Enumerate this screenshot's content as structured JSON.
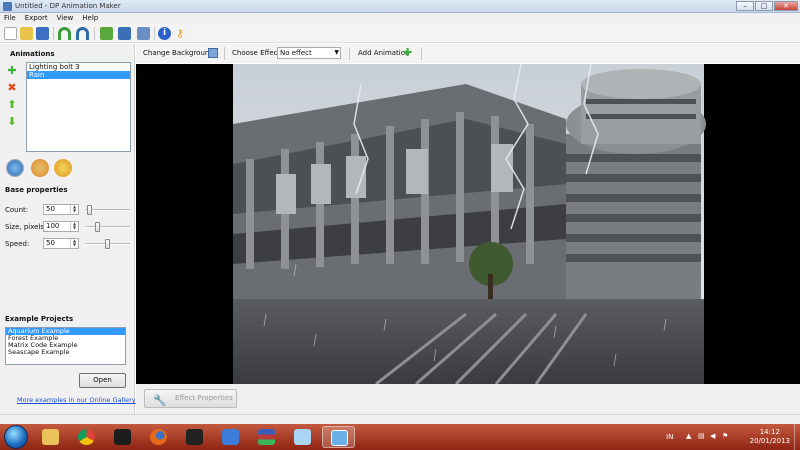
{
  "window": {
    "title": "Untitled - DP Animation Maker"
  },
  "menu": [
    "File",
    "Export",
    "View",
    "Help"
  ],
  "toolbar": {
    "icons": [
      "new-file-icon",
      "open-folder-icon",
      "save-icon",
      "undo-icon",
      "redo-icon",
      "export-image-icon",
      "export-video-icon",
      "export-screensaver-icon",
      "info-icon",
      "key-icon"
    ]
  },
  "animations": {
    "title": "Animations",
    "items": [
      {
        "label": "Lighting bolt 3",
        "selected": false
      },
      {
        "label": "Rain",
        "selected": true
      }
    ]
  },
  "base_properties": {
    "title": "Base properties",
    "rows": [
      {
        "label": "Count:",
        "value": "50",
        "slider": 0.05
      },
      {
        "label": "Size, pixels:",
        "value": "100",
        "slider": 0.25
      },
      {
        "label": "Speed:",
        "value": "50",
        "slider": 0.5
      }
    ]
  },
  "examples": {
    "title": "Example Projects",
    "items": [
      {
        "label": "Aquarium Example",
        "selected": true
      },
      {
        "label": "Forest Example",
        "selected": false
      },
      {
        "label": "Matrix Code Example",
        "selected": false
      },
      {
        "label": "Seascape Example",
        "selected": false
      }
    ],
    "open_label": "Open",
    "gallery_link": "More examples in our Online Gallery"
  },
  "effect_toolbar": {
    "change_background": "Change Background",
    "choose_effect_label": "Choose Effect:",
    "effect_value": "No effect",
    "add_animation": "Add Animation"
  },
  "bottom": {
    "effect_properties": "Effect Properties"
  },
  "taskbar": {
    "apps": [
      "folder",
      "chrome",
      "media-player",
      "firefox",
      "nero",
      "messenger",
      "winrar",
      "notepad",
      "dp-animation-maker"
    ],
    "lang": "IN",
    "time": "14:12",
    "date": "20/01/2013"
  },
  "colors": {
    "selection": "#3399ff",
    "taskbar": "#b23b22",
    "link": "#1a4fd0"
  }
}
